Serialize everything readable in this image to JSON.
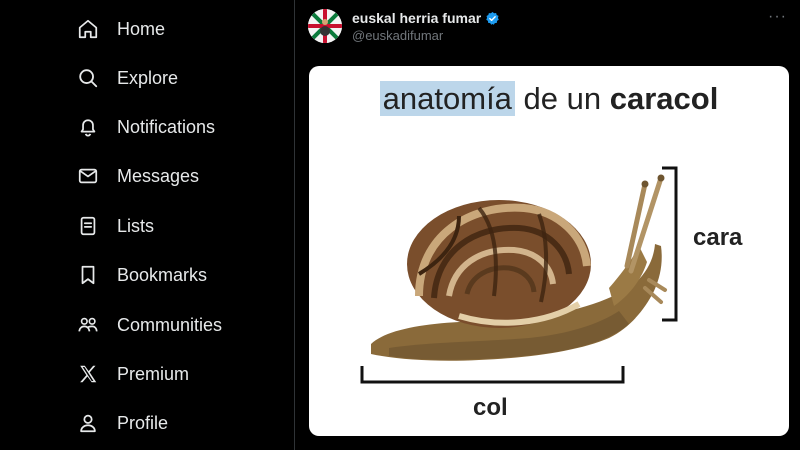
{
  "sidebar": {
    "items": [
      {
        "label": "Home",
        "icon": "home-icon"
      },
      {
        "label": "Explore",
        "icon": "search-icon"
      },
      {
        "label": "Notifications",
        "icon": "bell-icon"
      },
      {
        "label": "Messages",
        "icon": "envelope-icon"
      },
      {
        "label": "Lists",
        "icon": "list-icon"
      },
      {
        "label": "Bookmarks",
        "icon": "bookmark-icon"
      },
      {
        "label": "Communities",
        "icon": "communities-icon"
      },
      {
        "label": "Premium",
        "icon": "x-logo-icon"
      },
      {
        "label": "Profile",
        "icon": "person-icon"
      }
    ]
  },
  "tweet": {
    "author_name": "euskal herria fumar",
    "author_handle": "@euskadifumar",
    "verified": true,
    "more_label": "···",
    "media": {
      "title_highlight": "anatomía",
      "title_middle": " de un ",
      "title_bold": "caracol",
      "label_top": "cara",
      "label_bottom": "col"
    }
  },
  "colors": {
    "background": "#000000",
    "text": "#e7e9ea",
    "secondary_text": "#71767b",
    "verified_blue": "#1d9bf0",
    "highlight": "#bcd6ea"
  }
}
